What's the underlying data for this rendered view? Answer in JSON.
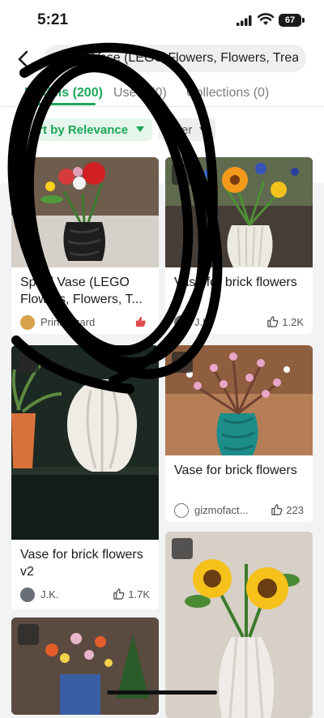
{
  "status": {
    "time": "5:21",
    "battery": "67"
  },
  "search": {
    "query": "Spiral Vase (LEGO Flowers, Flowers, Treasure Flowers)"
  },
  "tabs": [
    {
      "label": "Models (200)"
    },
    {
      "label": "Users (0)"
    },
    {
      "label": "Collections (0)"
    }
  ],
  "filters": {
    "sort": "Sort by Relevance",
    "filter": "Filter"
  },
  "cards": [
    {
      "title": "Spiral Vase (LEGO Flowers, Flowers, T...",
      "author": "PrintWizard",
      "likes": ""
    },
    {
      "title": "Vase for brick flowers",
      "author": "J.K.",
      "likes": "1.2K"
    },
    {
      "title": "",
      "author": "",
      "likes": ""
    },
    {
      "title": "Vase for brick flowers",
      "author": "gizmofact...",
      "likes": "223"
    },
    {
      "title": "Vase for brick flowers v2",
      "author": "J.K.",
      "likes": "1.7K"
    },
    {
      "title": "",
      "author": "",
      "likes": ""
    },
    {
      "title": "",
      "author": "",
      "likes": ""
    }
  ],
  "colors": {
    "accent": "#1ca65a",
    "background": "#f2f3f5",
    "annotation": "#000000"
  },
  "icons": [
    "back-arrow-icon",
    "thumbs-up-icon",
    "print-profile-icon",
    "signal-icon",
    "wifi-icon",
    "battery-icon"
  ]
}
